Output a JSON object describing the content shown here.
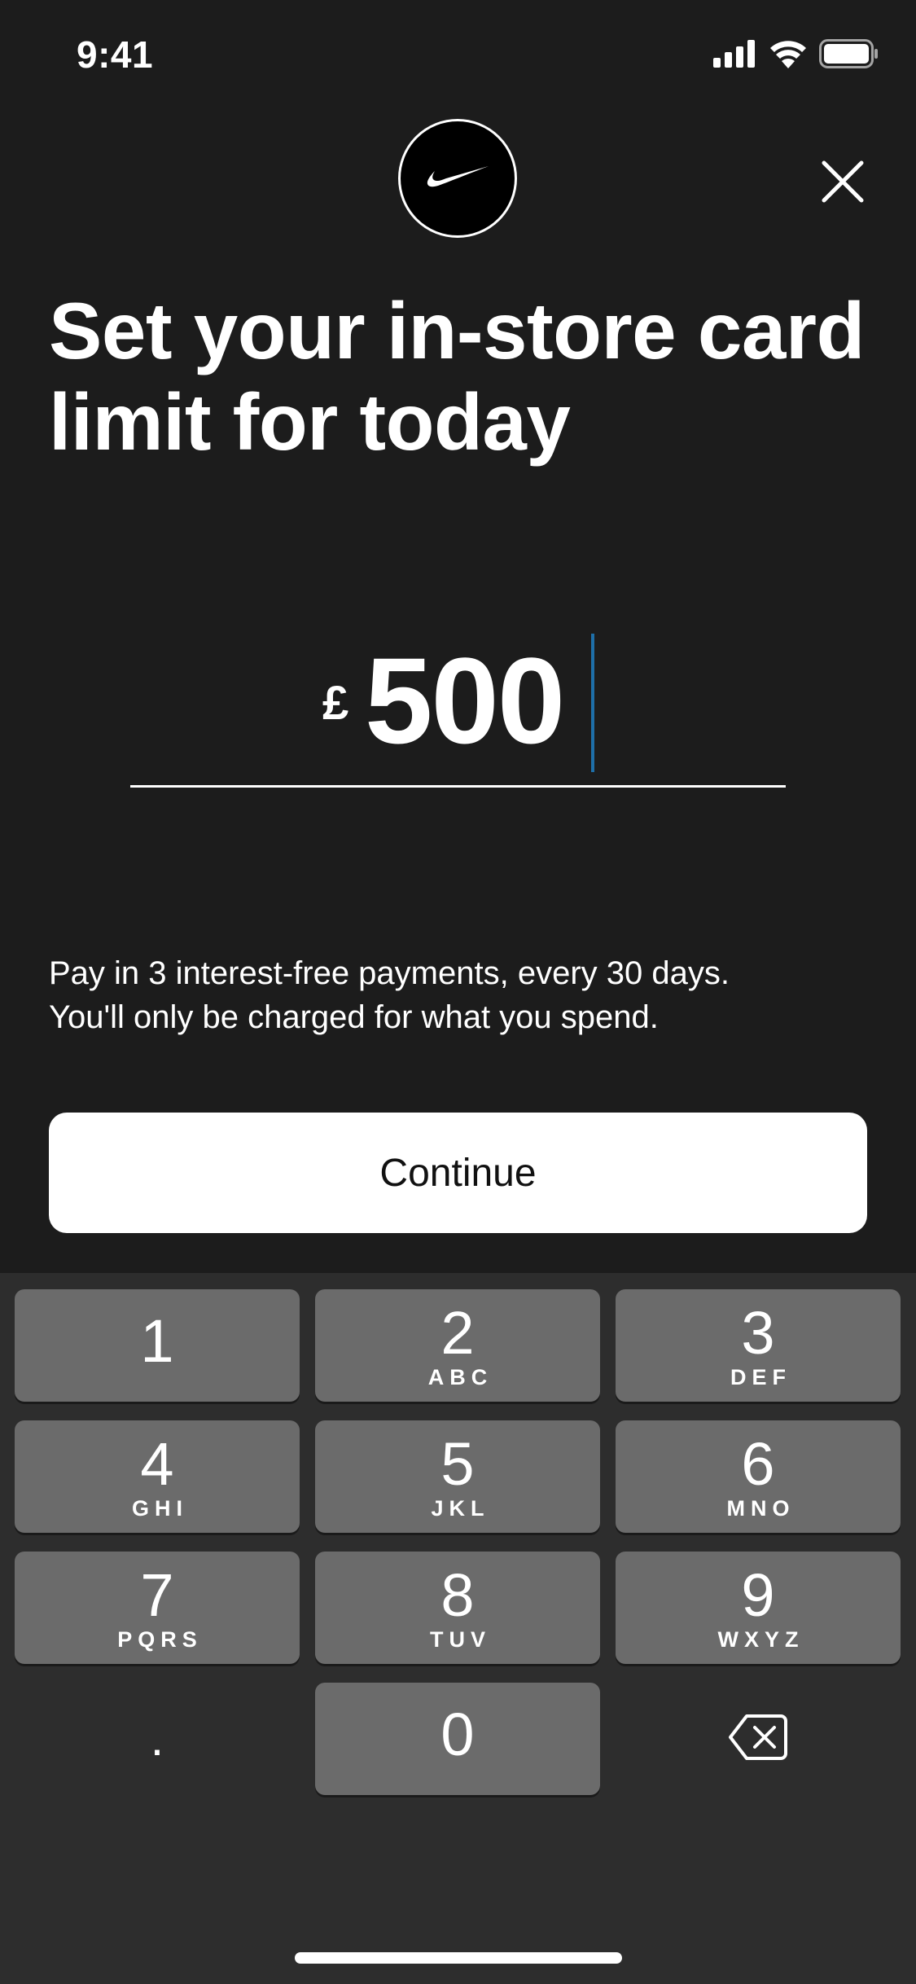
{
  "status_bar": {
    "time": "9:41",
    "signal_icon": "cellular-signal-icon",
    "wifi_icon": "wifi-icon",
    "battery_icon": "battery-icon"
  },
  "header": {
    "logo_icon": "swoosh-logo-icon",
    "close_icon": "close-icon"
  },
  "title": "Set your in-store card limit for today",
  "amount_input": {
    "currency": "£",
    "value": "500"
  },
  "info": {
    "line1": "Pay in 3 interest-free payments, every 30 days.",
    "line2": "You'll only be charged for what you spend."
  },
  "continue_label": "Continue",
  "keypad": {
    "keys": [
      {
        "digit": "1",
        "letters": ""
      },
      {
        "digit": "2",
        "letters": "ABC"
      },
      {
        "digit": "3",
        "letters": "DEF"
      },
      {
        "digit": "4",
        "letters": "GHI"
      },
      {
        "digit": "5",
        "letters": "JKL"
      },
      {
        "digit": "6",
        "letters": "MNO"
      },
      {
        "digit": "7",
        "letters": "PQRS"
      },
      {
        "digit": "8",
        "letters": "TUV"
      },
      {
        "digit": "9",
        "letters": "WXYZ"
      },
      {
        "digit": "0",
        "letters": ""
      }
    ],
    "decimal": ".",
    "delete_icon": "backspace-icon"
  },
  "colors": {
    "background": "#1c1c1c",
    "keyboard": "#2d2d2d",
    "key": "#6b6b6b",
    "caret": "#1e6fa8",
    "button": "#ffffff"
  }
}
